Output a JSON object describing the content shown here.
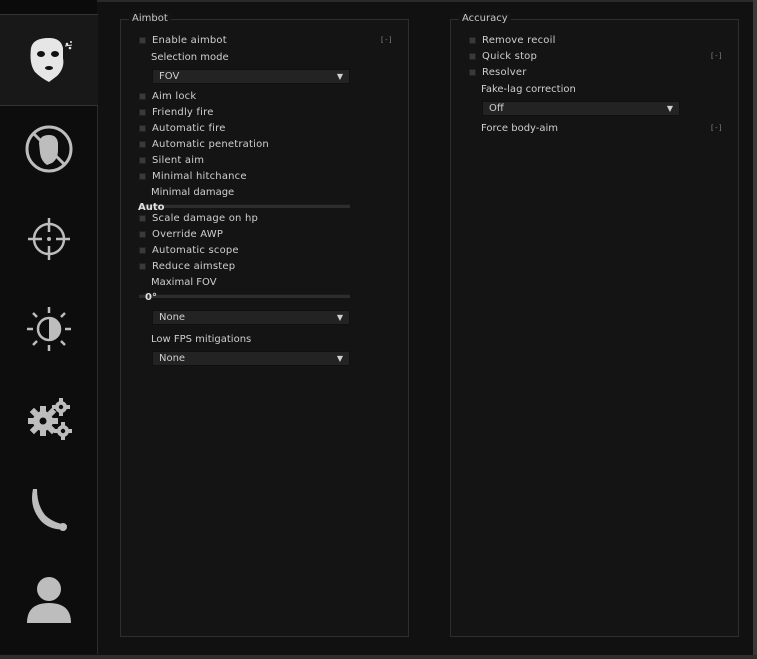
{
  "sidebar": {
    "tabs": [
      {
        "name": "rage",
        "icon": "masked-head-icon",
        "active": true
      },
      {
        "name": "antiaim",
        "icon": "no-head-icon",
        "active": false
      },
      {
        "name": "legit",
        "icon": "crosshair-icon",
        "active": false
      },
      {
        "name": "visuals",
        "icon": "half-sun-icon",
        "active": false
      },
      {
        "name": "misc",
        "icon": "gears-icon",
        "active": false
      },
      {
        "name": "skins",
        "icon": "knife-icon",
        "active": false
      },
      {
        "name": "players",
        "icon": "user-icon",
        "active": false
      }
    ]
  },
  "aimbot": {
    "title": "Aimbot",
    "enable_aimbot": "Enable aimbot",
    "enable_aimbot_key": "[-]",
    "selection_mode_label": "Selection mode",
    "selection_mode_value": "FOV",
    "aim_lock": "Aim lock",
    "friendly_fire": "Friendly fire",
    "automatic_fire": "Automatic fire",
    "automatic_penetration": "Automatic penetration",
    "silent_aim": "Silent aim",
    "minimal_hitchance": "Minimal hitchance",
    "minimal_damage_label": "Minimal damage",
    "minimal_damage_value": "Auto",
    "scale_damage": "Scale damage on hp",
    "override_awp": "Override AWP",
    "automatic_scope": "Automatic scope",
    "reduce_aimstep": "Reduce aimstep",
    "maximal_fov_label": "Maximal FOV",
    "maximal_fov_value": "0°",
    "unnamed_dropdown_value": "None",
    "low_fps_label": "Low FPS mitigations",
    "low_fps_value": "None"
  },
  "accuracy": {
    "title": "Accuracy",
    "remove_recoil": "Remove recoil",
    "quick_stop": "Quick stop",
    "quick_stop_key": "[-]",
    "resolver": "Resolver",
    "fakelag_label": "Fake-lag correction",
    "fakelag_value": "Off",
    "force_body_aim": "Force body-aim",
    "force_body_aim_key": "[-]"
  },
  "dropdown_arrow": "▼",
  "colors": {
    "background": "#111111",
    "panel": "#141414",
    "text": "#cfcfcf",
    "checkbox": "#3a3a3a",
    "icon": "#dcdcdc"
  }
}
